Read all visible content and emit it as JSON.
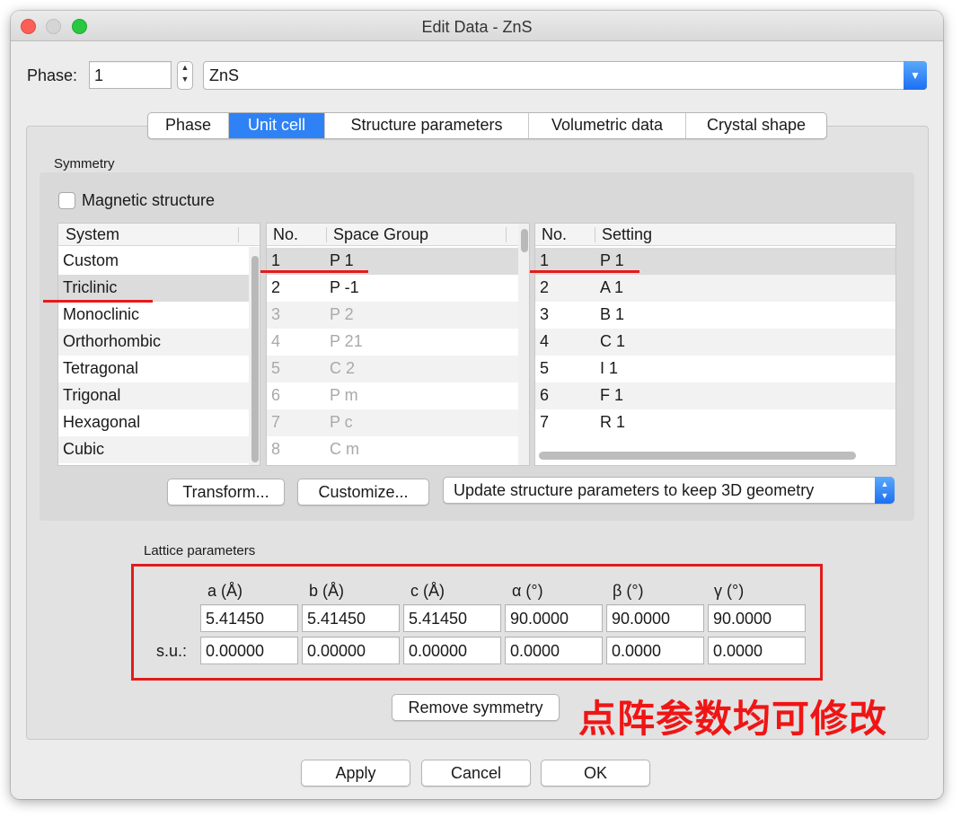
{
  "window": {
    "title": "Edit Data - ZnS"
  },
  "phase": {
    "label": "Phase:",
    "number": "1",
    "name": "ZnS"
  },
  "tabs": [
    {
      "label": "Phase"
    },
    {
      "label": "Unit cell"
    },
    {
      "label": "Structure parameters"
    },
    {
      "label": "Volumetric data"
    },
    {
      "label": "Crystal shape"
    }
  ],
  "symmetry": {
    "title": "Symmetry",
    "magnetic_label": "Magnetic structure",
    "system_header": "System",
    "systems": [
      "Custom",
      "Triclinic",
      "Monoclinic",
      "Orthorhombic",
      "Tetragonal",
      "Trigonal",
      "Hexagonal",
      "Cubic"
    ],
    "sg_headers": {
      "no": "No.",
      "name": "Space Group"
    },
    "space_groups": [
      {
        "no": "1",
        "name": "P 1"
      },
      {
        "no": "2",
        "name": "P -1"
      },
      {
        "no": "3",
        "name": "P 2"
      },
      {
        "no": "4",
        "name": "P 21"
      },
      {
        "no": "5",
        "name": "C 2"
      },
      {
        "no": "6",
        "name": "P m"
      },
      {
        "no": "7",
        "name": "P c"
      },
      {
        "no": "8",
        "name": "C m"
      }
    ],
    "setting_headers": {
      "no": "No.",
      "name": "Setting"
    },
    "settings": [
      {
        "no": "1",
        "name": "P 1"
      },
      {
        "no": "2",
        "name": "A 1"
      },
      {
        "no": "3",
        "name": "B 1"
      },
      {
        "no": "4",
        "name": "C 1"
      },
      {
        "no": "5",
        "name": "I 1"
      },
      {
        "no": "6",
        "name": "F 1"
      },
      {
        "no": "7",
        "name": "R 1"
      }
    ],
    "transform_label": "Transform...",
    "customize_label": "Customize...",
    "update_option": "Update structure parameters to keep 3D geometry"
  },
  "lattice": {
    "title": "Lattice parameters",
    "headers": [
      "a (Å)",
      "b (Å)",
      "c (Å)",
      "α (°)",
      "β (°)",
      "γ (°)"
    ],
    "values": [
      "5.41450",
      "5.41450",
      "5.41450",
      "90.0000",
      "90.0000",
      "90.0000"
    ],
    "su_label": "s.u.:",
    "su": [
      "0.00000",
      "0.00000",
      "0.00000",
      "0.0000",
      "0.0000",
      "0.0000"
    ]
  },
  "remove_symmetry_label": "Remove symmetry",
  "annotation": "点阵参数均可修改",
  "footer": {
    "apply": "Apply",
    "cancel": "Cancel",
    "ok": "OK"
  },
  "colors": {
    "accent": "#2f82f5",
    "annotation_red": "#e31b1b"
  }
}
